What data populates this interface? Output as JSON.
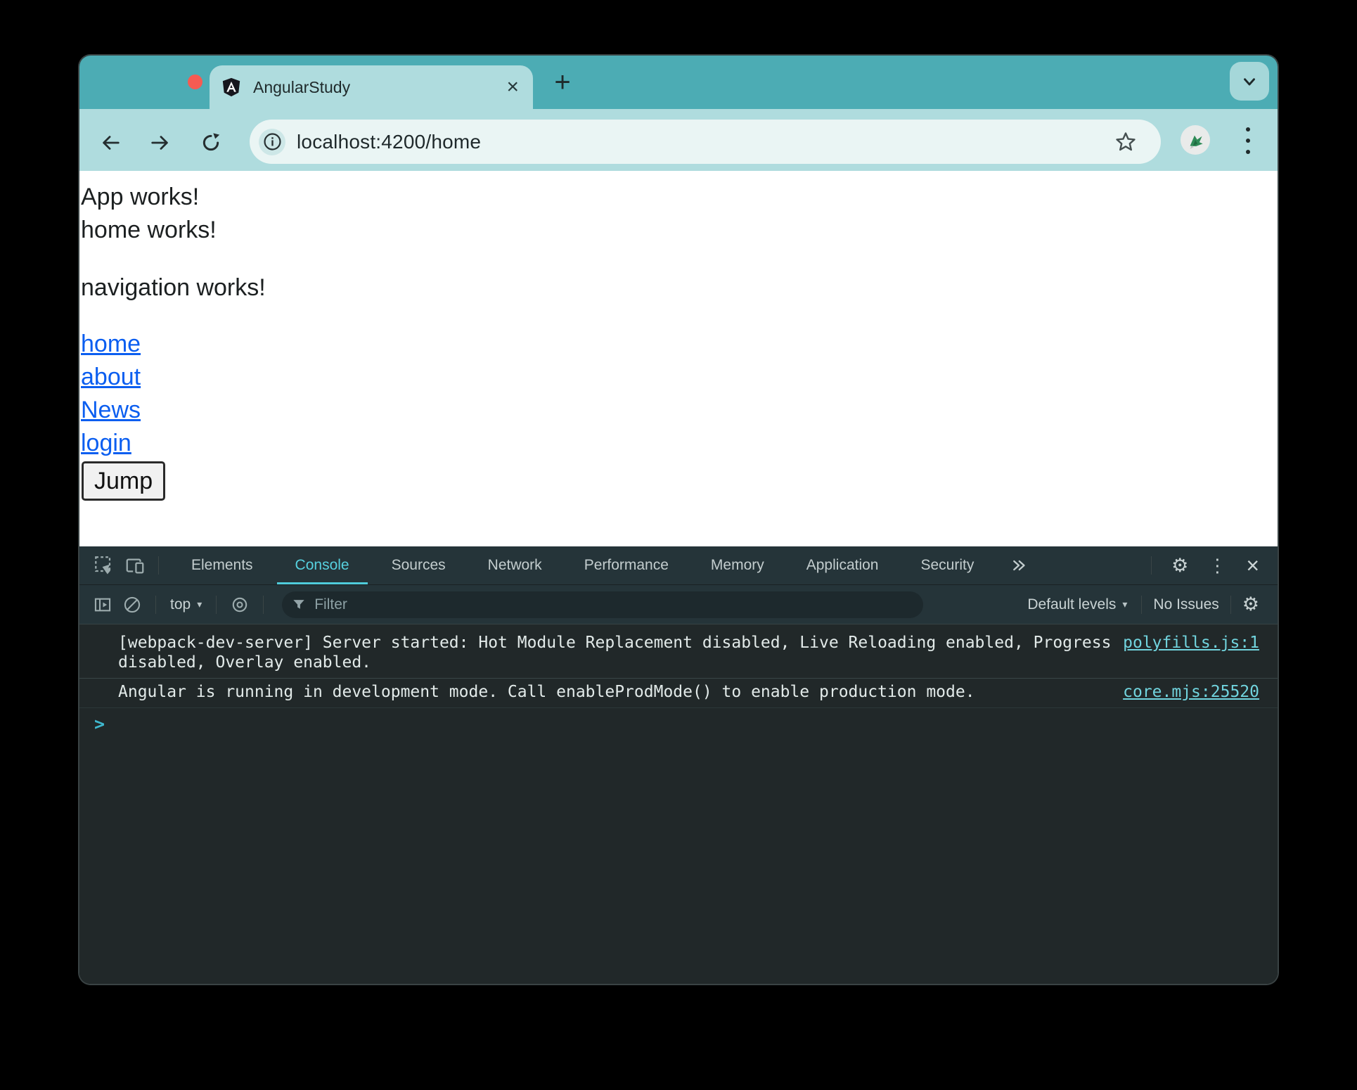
{
  "browser": {
    "tab_title": "AngularStudy",
    "url": "localhost:4200/home"
  },
  "page": {
    "app_text": "App works!",
    "home_text": "home works!",
    "nav_text": "navigation works!",
    "links": [
      {
        "label": "home"
      },
      {
        "label": "about"
      },
      {
        "label": "News"
      },
      {
        "label": "login"
      }
    ],
    "jump_label": "Jump"
  },
  "devtools": {
    "tabs": [
      {
        "label": "Elements"
      },
      {
        "label": "Console",
        "active": true
      },
      {
        "label": "Sources"
      },
      {
        "label": "Network"
      },
      {
        "label": "Performance"
      },
      {
        "label": "Memory"
      },
      {
        "label": "Application"
      },
      {
        "label": "Security"
      }
    ],
    "toolbar": {
      "context_label": "top",
      "filter_placeholder": "Filter",
      "levels_label": "Default levels",
      "issues_label": "No Issues"
    },
    "console": {
      "messages": [
        {
          "text": "[webpack-dev-server] Server started: Hot Module Replacement disabled, Live Reloading enabled, Progress disabled, Overlay enabled.",
          "source": "polyfills.js:1"
        },
        {
          "text": "Angular is running in development mode. Call enableProdMode() to enable production mode.",
          "source": "core.mjs:25520"
        }
      ],
      "prompt_chevron": ">"
    }
  },
  "icons": {
    "close_x": "×",
    "plus": "+",
    "settings_gear": "⚙",
    "devtools_menu": "⋮",
    "dropdown_caret": "▾"
  },
  "colors": {
    "titlebar": "#4CACB4",
    "toolbar": "#AFDCDE",
    "url_pill": "#EAF5F4",
    "link_blue": "#0B5EF0",
    "devtools_bar": "#253439",
    "console_bg": "#212829",
    "console_link": "#71D4DE",
    "active_tab_accent": "#56D1DF",
    "prompt_accent": "#3FB9CF"
  }
}
